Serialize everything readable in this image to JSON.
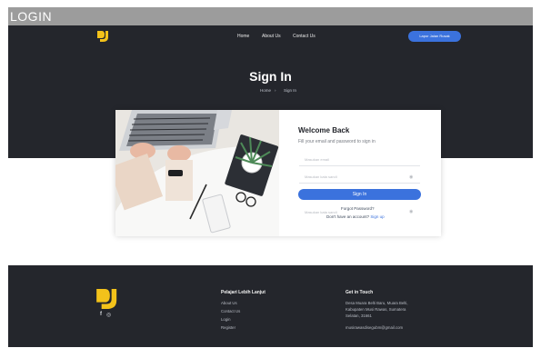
{
  "page_label": "LOGIN",
  "nav": {
    "items": [
      "Home",
      "About Us",
      "Contact Us"
    ],
    "report_button": "Lapor Jalan Rusak"
  },
  "hero": {
    "title": "Sign In",
    "breadcrumb": [
      "Home",
      "Sign In"
    ]
  },
  "form": {
    "title": "Welcome Back",
    "subtitle": "Fill your email and password to sign in",
    "email_placeholder": "Masukan email",
    "password_placeholder": "Masukan kata sandi",
    "signin_label": "Sign In",
    "ghost_placeholder": "Masukan kata sandi",
    "forgot_label": "Forgot Password?",
    "register_prompt": "Don't have an account?",
    "register_link": "Sign up"
  },
  "footer": {
    "section1": {
      "title": "Pelajari Lebih Lanjut",
      "links": [
        "About Us",
        "Contact Us",
        "Login",
        "Register"
      ]
    },
    "section2": {
      "title": "Get in Touch",
      "address": [
        "Desa Muara Belti Baru, Muara Belti,",
        "Kabupaten Musi Rawas, Sumatera",
        "Selatan, 31661"
      ],
      "email": "musirawasdisegubm@gmail.com"
    },
    "social": [
      "facebook-icon",
      "instagram-icon"
    ]
  },
  "colors": {
    "dark": "#24262c",
    "accent": "#3b72dd",
    "logo": "#f3c21a"
  }
}
